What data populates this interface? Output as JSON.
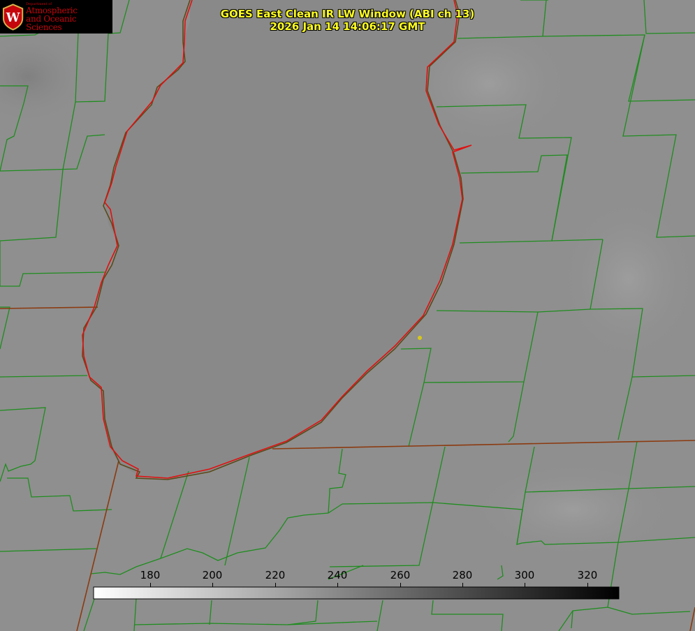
{
  "logo": {
    "line1": "Department of",
    "line2": "Atmospheric",
    "line3": "and Oceanic Sciences"
  },
  "title": {
    "line1": "GOES East Clean IR LW Window (ABI ch 13)",
    "line2": "2026 Jan 14 14:06:17 GMT"
  },
  "colorbar": {
    "ticks": [
      "180",
      "200",
      "220",
      "240",
      "260",
      "280",
      "300",
      "320"
    ],
    "gradient_start": "#ffffff",
    "gradient_end": "#000000"
  },
  "colors": {
    "county_lines": "#1e8c1e",
    "state_lines": "#8b3a0f",
    "lake_shore": "#e01010",
    "marker": "#d8c81a"
  }
}
